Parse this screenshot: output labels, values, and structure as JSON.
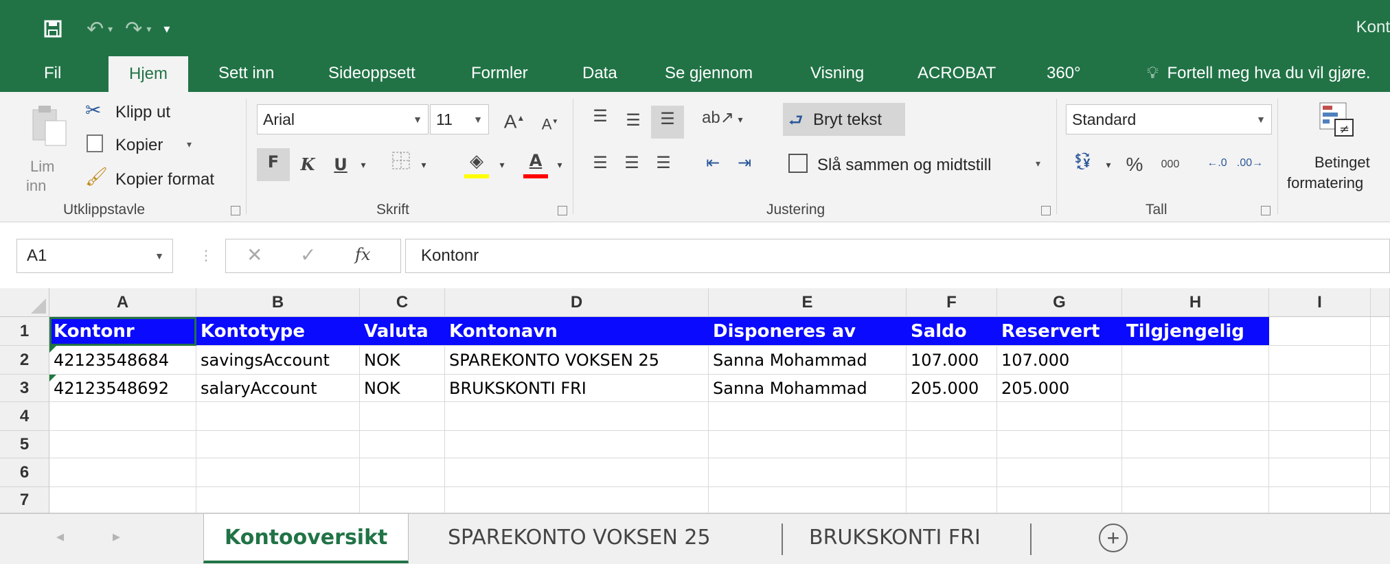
{
  "window": {
    "title": "Kont"
  },
  "tabs": [
    "Fil",
    "Hjem",
    "Sett inn",
    "Sideoppsett",
    "Formler",
    "Data",
    "Se gjennom",
    "Visning",
    "ACROBAT",
    "360°"
  ],
  "tell_me": "Fortell meg hva du vil gjøre.",
  "clipboard": {
    "paste_label": [
      "Lim",
      "inn"
    ],
    "cut_label": "Klipp ut",
    "copy_label": "Kopier",
    "format_painter_label": "Kopier format",
    "group_label": "Utklippstavle"
  },
  "font": {
    "font_name": "Arial",
    "font_size": "11",
    "bold": "F",
    "italic": "K",
    "underline": "U",
    "grow": "A",
    "shrink": "A",
    "group_label": "Skrift"
  },
  "alignment": {
    "wrap_label": "Bryt tekst",
    "merge_label": "Slå sammen og midtstill",
    "group_label": "Justering"
  },
  "number": {
    "format": "Standard",
    "percent": "%",
    "thousands": "000",
    "group_label": "Tall"
  },
  "styles": {
    "cond_format_label": [
      "Betinget",
      "formatering"
    ]
  },
  "formula_bar": {
    "name_box": "A1",
    "fx": "fx",
    "content": "Kontonr"
  },
  "columns": [
    "A",
    "B",
    "C",
    "D",
    "E",
    "F",
    "G",
    "H",
    "I"
  ],
  "rows": [
    "1",
    "2",
    "3",
    "4",
    "5",
    "6",
    "7"
  ],
  "sheet": {
    "header": [
      "Kontonr",
      "Kontotype",
      "Valuta",
      "Kontonavn",
      "Disponeres av",
      "Saldo",
      "Reservert",
      "Tilgjengelig"
    ],
    "data": [
      [
        "42123548684",
        "savingsAccount",
        "NOK",
        "SPAREKONTO VOKSEN 25",
        "Sanna Mohammad",
        "107.000",
        "107.000",
        ""
      ],
      [
        "42123548692",
        "salaryAccount",
        "NOK",
        "BRUKSKONTI FRI",
        "Sanna Mohammad",
        "205.000",
        "205.000",
        ""
      ]
    ]
  },
  "sheet_tabs": [
    "Kontooversikt",
    "SPAREKONTO VOKSEN 25",
    "BRUKSKONTI FRI"
  ],
  "colors": {
    "excel_green": "#217346",
    "header_fill": "#0a0aff",
    "header_text": "#ffffff"
  }
}
